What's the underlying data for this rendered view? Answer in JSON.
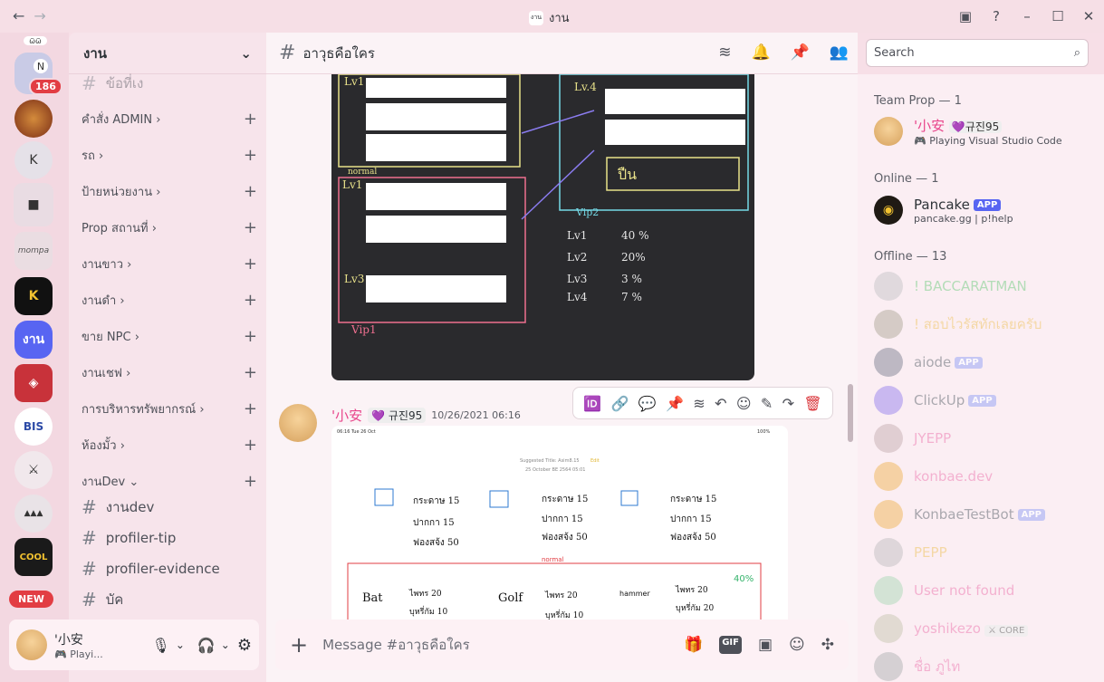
{
  "window": {
    "title": "งาน",
    "title_icon": "งาน",
    "back": "←",
    "forward": "→"
  },
  "servers": {
    "badge_count": "186",
    "new_label": "NEW",
    "k_label": "K",
    "active_label": "งาน",
    "folder_label": "N"
  },
  "guild": {
    "name": "งาน"
  },
  "categories": [
    {
      "label": "คำสั่ง ADMIN",
      "chev": "›"
    },
    {
      "label": "รถ",
      "chev": "›"
    },
    {
      "label": "ป้ายหน่วยงาน",
      "chev": "›"
    },
    {
      "label": "Prop สถานที่",
      "chev": "›"
    },
    {
      "label": "งานขาว",
      "chev": "›"
    },
    {
      "label": "งานดำ",
      "chev": "›"
    },
    {
      "label": "ขาย NPC",
      "chev": "›"
    },
    {
      "label": "งานเชฟ",
      "chev": "›"
    },
    {
      "label": "การบริหารทรัพยากรณ์",
      "chev": "›"
    },
    {
      "label": "ห้องมั้ว",
      "chev": "›"
    },
    {
      "label": "งานDev",
      "chev": "⌄"
    }
  ],
  "top_channel": "ข้อที่เง",
  "dev_channels": [
    "งานdev",
    "profiler-tip",
    "profiler-evidence",
    "บัค"
  ],
  "user": {
    "name": "'小安",
    "status": "Playi..."
  },
  "channel": {
    "name": "อาวุธคือใคร",
    "search_placeholder": "Search"
  },
  "message": {
    "author": "'小安",
    "tag": "규진95",
    "timestamp": "10/26/2021 06:16"
  },
  "drawing1": {
    "labels": [
      "Lv1",
      "normal",
      "Lv1",
      "Lv3",
      "Vip1",
      "Lv.4",
      "ปืน",
      "Vip2"
    ],
    "stats": [
      [
        "Lv1",
        "40 %"
      ],
      [
        "Lv2",
        "20%"
      ],
      [
        "Lv3",
        "3 %"
      ],
      [
        "Lv4",
        "7 %"
      ]
    ]
  },
  "drawing2": {
    "header_left": "06:16  Tue 26 Oct",
    "header_right": "100%",
    "suggested_title": "Suggested Title: Asim8.15",
    "edit_label": "Edit",
    "date_line": "25 October BE 2564 05:01",
    "block1": [
      "กระดาษ 15",
      "ปากกา 15",
      "ฟองสจ้ง 50"
    ],
    "block2": [
      "กระดาษ 15",
      "ปากกา 15",
      "ฟองสจ้ง 50"
    ],
    "block3": [
      "กระดาษ 15",
      "ปากกา 15",
      "ฟองสจ้ง 50"
    ],
    "normal_label": "normal",
    "bat": "Bat",
    "golf": "Golf",
    "hammer": "hammer",
    "bat_items": [
      "ไพทร 20",
      "บุหรี่กัม 10"
    ],
    "golf_items": [
      "ไพทร 20",
      "บุหรี่กัม 10"
    ],
    "hammer_items": [
      "ไพทร 20",
      "บุหรี่กัม 20"
    ],
    "percent": "40%"
  },
  "composer": {
    "placeholder": "Message #อาวุธคือใคร",
    "gif": "GIF"
  },
  "members": {
    "team_header": "Team Prop — 1",
    "online_header": "Online — 1",
    "offline_header": "Offline — 13",
    "team": [
      {
        "name": "'小安",
        "tag": "규진95",
        "activity": "Playing Visual Studio Code"
      }
    ],
    "online": [
      {
        "name": "Pancake",
        "app": "APP",
        "activity": "pancake.gg | p!help"
      }
    ],
    "offline": [
      {
        "name": "! BACCARATMAN",
        "color": "#9bd6a3"
      },
      {
        "name": "! สอบไวรัสทักเลยครับ",
        "color": "#f2d08a"
      },
      {
        "name": "aiode",
        "color": "#8e9097",
        "app": "APP"
      },
      {
        "name": "ClickUp",
        "color": "#8e9097",
        "app": "APP"
      },
      {
        "name": "JYEPP",
        "color": "#f19cc4"
      },
      {
        "name": "konbae.dev",
        "color": "#f19cc4"
      },
      {
        "name": "KonbaeTestBot",
        "color": "#8e9097",
        "app": "APP"
      },
      {
        "name": "PEPP",
        "color": "#f2d08a"
      },
      {
        "name": "User not found",
        "color": "#f19cc4"
      },
      {
        "name": "yoshikezo",
        "color": "#f19cc4",
        "tag": "CORE"
      },
      {
        "name": "ชื่อ ภูไท",
        "color": "#f19cc4"
      }
    ]
  }
}
